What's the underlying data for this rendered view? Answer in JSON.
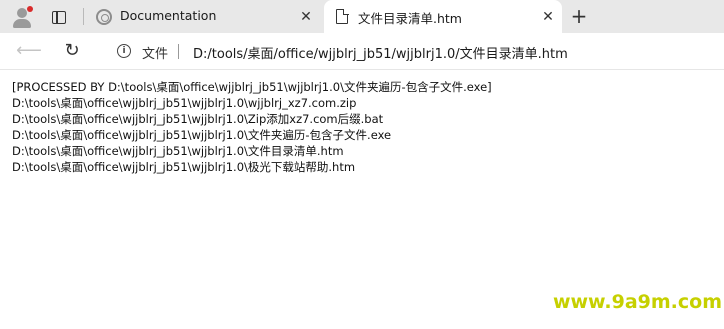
{
  "tabs": [
    {
      "title": "Documentation",
      "favicon": "loading-circle-icon",
      "active": false
    },
    {
      "title": "文件目录清单.htm",
      "favicon": "document-icon",
      "active": true
    }
  ],
  "toolbar": {
    "scheme_label": "文件",
    "url": "D:/tools/桌面/office/wjjblrj_jb51/wjjblrj1.0/文件目录清单.htm"
  },
  "content": {
    "lines": [
      "[PROCESSED BY D:\\tools\\桌面\\office\\wjjblrj_jb51\\wjjblrj1.0\\文件夹遍历-包含子文件.exe]",
      "D:\\tools\\桌面\\office\\wjjblrj_jb51\\wjjblrj1.0\\wjjblrj_xz7.com.zip",
      "D:\\tools\\桌面\\office\\wjjblrj_jb51\\wjjblrj1.0\\Zip添加xz7.com后缀.bat",
      "D:\\tools\\桌面\\office\\wjjblrj_jb51\\wjjblrj1.0\\文件夹遍历-包含子文件.exe",
      "D:\\tools\\桌面\\office\\wjjblrj_jb51\\wjjblrj1.0\\文件目录清单.htm",
      "D:\\tools\\桌面\\office\\wjjblrj_jb51\\wjjblrj1.0\\极光下载站帮助.htm"
    ]
  },
  "watermark": "www.9a9m.com",
  "colors": {
    "tabstrip_bg": "#e8e8e8",
    "notification_dot": "#d92b2b",
    "watermark": "#c6d000"
  }
}
